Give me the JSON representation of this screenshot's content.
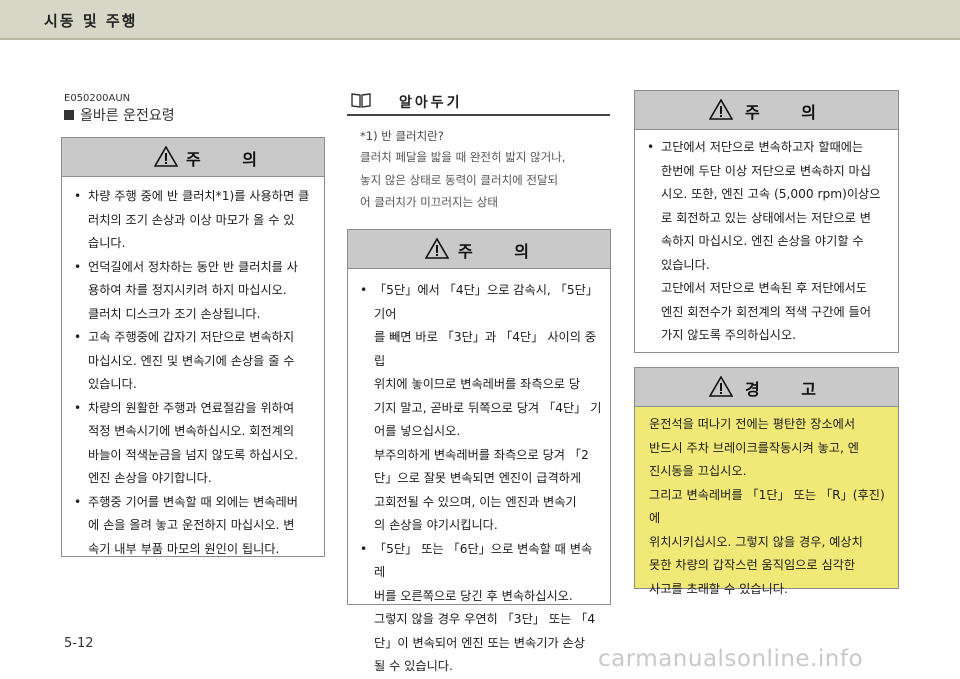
{
  "header": {
    "title": "시동 및 주행"
  },
  "section": {
    "code": "E050200AUN",
    "title": "올바른 운전요령"
  },
  "caution_left": {
    "heading": "주 의",
    "items": [
      {
        "first": "차량 주행 중에 반 클러치*1)를 사용하면 클",
        "rest": [
          "러치의 조기 손상과 이상 마모가 올 수 있",
          "습니다."
        ]
      },
      {
        "first": "언덕길에서 정차하는 동안 반 클러치를 사",
        "rest": [
          "용하여 차를 정지시키려 하지 마십시오.",
          "클러치 디스크가 조기 손상됩니다."
        ]
      },
      {
        "first": "고속 주행중에 갑자기 저단으로 변속하지",
        "rest": [
          "마십시오. 엔진 및 변속기에 손상을 줄 수",
          "있습니다."
        ]
      },
      {
        "first": "차량의 원활한 주행과 연료절감을 위하여",
        "rest": [
          "적정 변속시기에 변속하십시오. 회전계의",
          "바늘이 적색눈금을 넘지 않도록 하십시오.",
          "엔진 손상을 야기합니다."
        ]
      },
      {
        "first": "주행중 기어를 변속할 때 외에는 변속레버",
        "rest": [
          "에 손을 올려 놓고 운전하지 마십시오. 변",
          "속기 내부 부품 마모의 원인이 됩니다."
        ]
      }
    ]
  },
  "memo": {
    "title": "알아두기",
    "term": "*1) 반 클러치란?",
    "lines": [
      "클러치 페달을 밟을 때 완전히 밟지 않거나,",
      "놓지 않은 상태로 동력이 클러치에 전달되",
      "어 클러치가 미끄러지는 상태"
    ]
  },
  "caution_mid": {
    "heading": "주 의",
    "items": [
      {
        "first": "「5단」에서 「4단」으로 감속시, 「5단」 기어",
        "rest": [
          "를 빼면 바로 「3단」과 「4단」 사이의 중립",
          "위치에 놓이므로 변속레버를 좌측으로 당",
          "기지 말고, 곧바로 뒤쪽으로 당겨 「4단」 기",
          "어를 넣으십시오.",
          "부주의하게 변속레버를 좌측으로 당겨 「2",
          "단」으로 잘못 변속되면 엔진이 급격하게",
          "고회전될 수 있으며, 이는 엔진과 변속기",
          "의 손상을 야기시킵니다."
        ]
      },
      {
        "first": "「5단」 또는 「6단」으로 변속할 때 변속 레",
        "rest": [
          "버를 오른쪽으로 당긴 후 변속하십시오.",
          "그렇지 않을 경우 우연히 「3단」 또는 「4",
          "단」이 변속되어 엔진 또는 변속기가 손상",
          "될 수 있습니다."
        ]
      }
    ]
  },
  "caution_right": {
    "heading": "주 의",
    "items": [
      {
        "first": "고단에서 저단으로 변속하고자 할때에는",
        "rest": [
          "한번에 두단 이상 저단으로 변속하지 마십",
          "시오. 또한, 엔진 고속 (5,000 rpm)이상으",
          "로 회전하고 있는 상태에서는 저단으로 변",
          "속하지 마십시오. 엔진 손상을 야기할 수",
          "있습니다.",
          "고단에서 저단으로 변속된 후 저단에서도",
          "엔진 회전수가 회전계의 적색 구간에 들어",
          "가지 않도록 주의하십시오."
        ]
      }
    ]
  },
  "warning": {
    "heading": "경 고",
    "lines": [
      "운전석을 떠나기 전에는 평탄한 장소에서",
      "반드시 주차 브레이크를작동시켜 놓고, 엔",
      "진시동을 끄십시오.",
      "그리고 변속레버를 「1단」 또는 「R」(후진)에",
      "위치시키십시오. 그렇지 않을 경우, 예상치",
      "못한 차량의 갑작스런 움직임으로 심각한",
      "사고를 초래할 수 있습니다."
    ]
  },
  "footer": {
    "page_number": "5-12",
    "watermark": "carmanualsonline.info"
  },
  "colors": {
    "header_bg": "#d7d7c7",
    "box_head_bg": "#c9c9c9",
    "warning_bg": "#f0e877"
  }
}
